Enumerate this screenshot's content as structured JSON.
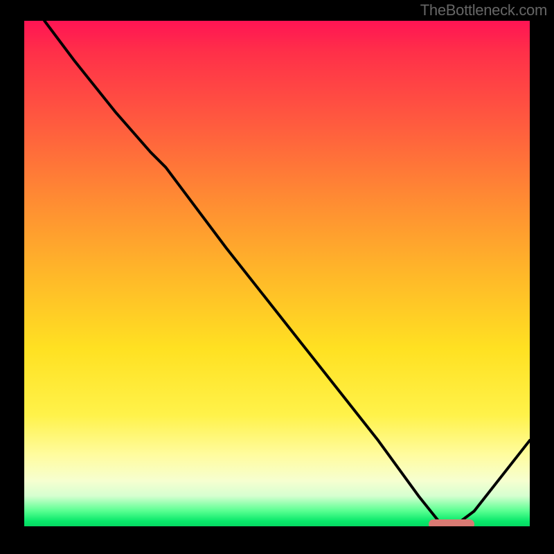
{
  "watermark": "TheBottleneck.com",
  "colors": {
    "curve": "#000000",
    "marker": "#d97a73",
    "background_top": "#ff1454",
    "background_bottom": "#06d862"
  },
  "chart_data": {
    "type": "line",
    "title": "",
    "xlabel": "",
    "ylabel": "",
    "xlim": [
      0,
      100
    ],
    "ylim": [
      0,
      100
    ],
    "grid": false,
    "legend": false,
    "series": [
      {
        "name": "bottleneck-curve",
        "x": [
          4,
          10,
          18,
          25,
          28,
          40,
          55,
          70,
          78,
          82,
          85,
          89,
          100
        ],
        "y": [
          100,
          92,
          82,
          74,
          71,
          55,
          36,
          17,
          6,
          1,
          0,
          3,
          17
        ]
      }
    ],
    "markers": [
      {
        "name": "optimal-zone",
        "x_start": 80,
        "x_end": 89,
        "y": 0
      }
    ],
    "notes": "y = bottleneck % (0 at bottom, 100 at top); x is an unlabeled hardware-range axis. Values estimated from pixel positions."
  }
}
